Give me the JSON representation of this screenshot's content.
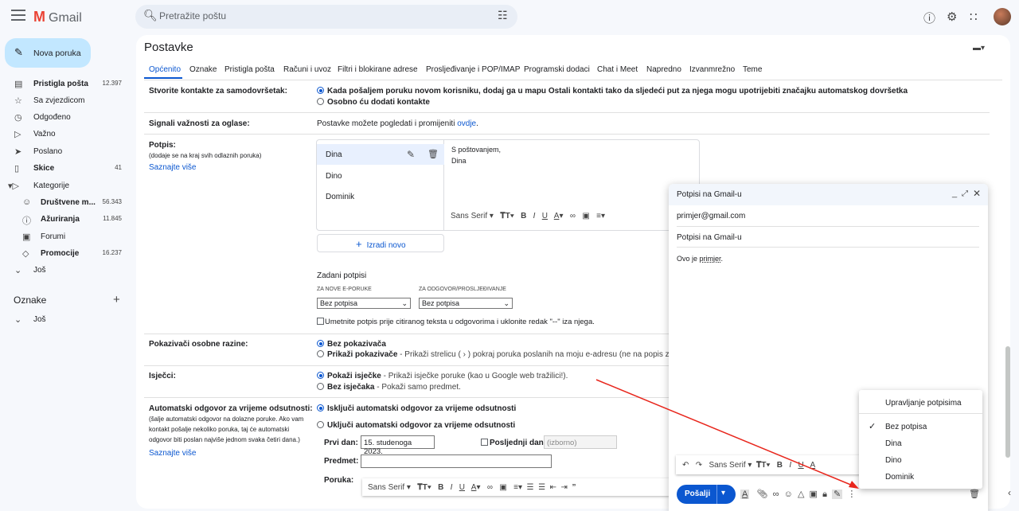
{
  "app": {
    "name": "Gmail",
    "logo_letter": "M"
  },
  "search": {
    "placeholder": "Pretražite poštu"
  },
  "sidebar": {
    "compose": "Nova poruka",
    "items": [
      {
        "label": "Pristigla pošta",
        "count": "12.397",
        "icon": "inbox-icon"
      },
      {
        "label": "Sa zvjezdicom",
        "count": "",
        "icon": "star-icon"
      },
      {
        "label": "Odgođeno",
        "count": "",
        "icon": "clock-icon"
      },
      {
        "label": "Važno",
        "count": "",
        "icon": "important-icon"
      },
      {
        "label": "Poslano",
        "count": "",
        "icon": "send-icon"
      },
      {
        "label": "Skice",
        "count": "41",
        "icon": "draft-icon"
      },
      {
        "label": "Kategorije",
        "count": "",
        "icon": "label-icon"
      },
      {
        "label": "Društvene m...",
        "count": "56.343",
        "icon": "people-icon"
      },
      {
        "label": "Ažuriranja",
        "count": "11.845",
        "icon": "info-icon"
      },
      {
        "label": "Forumi",
        "count": "",
        "icon": "forum-icon"
      },
      {
        "label": "Promocije",
        "count": "16.237",
        "icon": "tag-icon"
      },
      {
        "label": "Još",
        "count": "",
        "icon": "chevron-down-icon"
      }
    ],
    "labels_title": "Oznake",
    "labels_more": "Još"
  },
  "settings": {
    "title": "Postavke",
    "tabs": [
      "Općenito",
      "Oznake",
      "Pristigla pošta",
      "Računi i uvoz",
      "Filtri i blokirane adrese",
      "Prosljeđivanje i POP/IMAP",
      "Programski dodaci",
      "Chat i Meet",
      "Napredno",
      "Izvanmrežno",
      "Teme"
    ],
    "autocomplete": {
      "label": "Stvorite kontakte za samodovršetak:",
      "opt1": "Kada pošaljem poruku novom korisniku, dodaj ga u mapu Ostali kontakti tako da sljedeći put za njega mogu upotrijebiti značajku automatskog dovršetka",
      "opt2": "Osobno ću dodati kontakte"
    },
    "ads": {
      "label": "Signali važnosti za oglase:",
      "text": "Postavke možete pogledati i promijeniti ",
      "link": "ovdje",
      "end": "."
    },
    "signature": {
      "label": "Potpis:",
      "hint": "(dodaje se na kraj svih odlaznih poruka)",
      "learn": "Saznajte više",
      "names": [
        "Dina",
        "Dino",
        "Dominik"
      ],
      "body_line1": "S poštovanjem,",
      "body_line2": "Dina",
      "create": "Izradi novo",
      "defaults_title": "Zadani potpisi",
      "new_label": "ZA NOVE E-PORUKE",
      "reply_label": "ZA ODGOVOR/PROSLJEĐIVANJE",
      "new_value": "Bez potpisa",
      "reply_value": "Bez potpisa",
      "checkbox": "Umetnite potpis prije citiranog teksta u odgovorima i uklonite redak \"--\" iza njega."
    },
    "indicators": {
      "label": "Pokazivači osobne razine:",
      "opt1": "Bez pokazivača",
      "opt2": "Prikaži pokazivače",
      "opt2_desc": " - Prikaži strelicu ( › ) pokraj poruka poslanih na moju e-adresu (ne na popis za sla"
    },
    "snippets": {
      "label": "Isječci:",
      "opt1": "Pokaži isječke",
      "opt1_desc": " - Prikaži isječke poruke (kao u Google web tražilici!).",
      "opt2": "Bez isječaka",
      "opt2_desc": " - Pokaži samo predmet."
    },
    "vacation": {
      "label": "Automatski odgovor za vrijeme odsutnosti:",
      "hint": "(šalje automatski odgovor na dolazne poruke. Ako vam kontakt pošalje nekoliko poruka, taj će automatski odgovor biti poslan najviše jednom svaka četiri dana.)",
      "learn": "Saznajte više",
      "off": "Isključi automatski odgovor za vrijeme odsutnosti",
      "on": "Uključi automatski odgovor za vrijeme odsutnosti",
      "first_day": "Prvi dan:",
      "first_value": "15. studenoga 2023.",
      "last_day": "Posljednji dan:",
      "last_placeholder": "(izborno)",
      "subject": "Predmet:",
      "message": "Poruka:"
    },
    "font": "Sans Serif"
  },
  "popup": {
    "title": "Potpisi na Gmail-u",
    "from": "primjer@gmail.com",
    "subject": "Potpisi na Gmail-u",
    "body_a": "Ovo je ",
    "body_b": "primjer",
    "body_c": ".",
    "send": "Pošalji",
    "font": "Sans Serif"
  },
  "menu": {
    "manage": "Upravljanje potpisima",
    "items": [
      "Bez potpisa",
      "Dina",
      "Dino",
      "Dominik"
    ],
    "checked": "Bez potpisa"
  },
  "colors": {
    "accent": "#0b57d0",
    "compose_bg": "#c2e7ff",
    "arrow": "#e8261c"
  }
}
